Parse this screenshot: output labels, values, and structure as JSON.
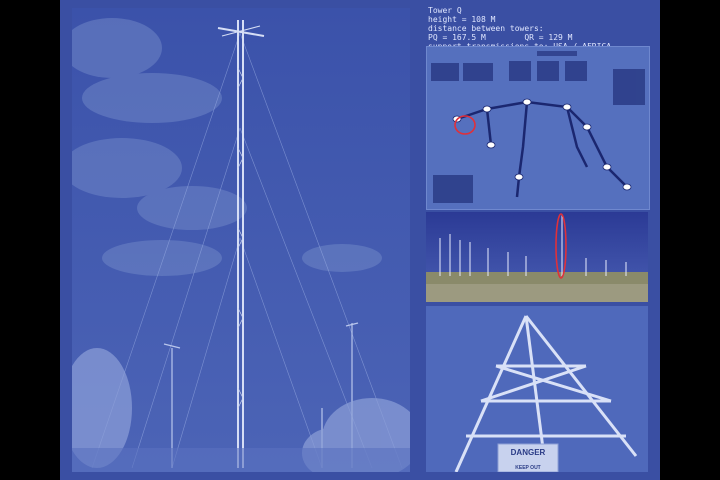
{
  "info": {
    "title": "Tower Q",
    "height": "height = 108 M",
    "distance_heading": "distance between towers:",
    "distances": "PQ = 167.5 M        QR = 129 M",
    "support": "support transmissions to: USA / AFRICA"
  },
  "sign": {
    "heading": "DANGER",
    "footer": "KEEP OUT"
  },
  "colors": {
    "tint": "#3a4fa3",
    "highlight": "#e0303a",
    "text": "#dfe6ff"
  }
}
